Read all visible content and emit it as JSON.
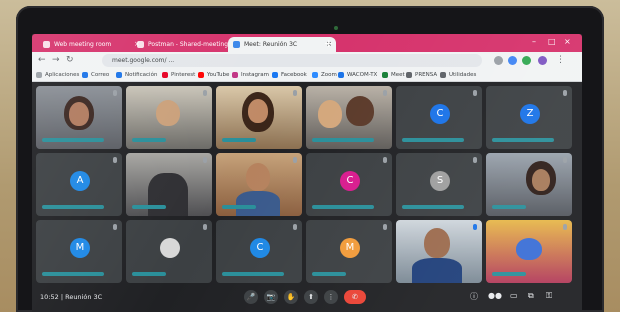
{
  "tabs": [
    {
      "label": "Web meeting room"
    },
    {
      "label": "Postman - Shared-meeting-..."
    },
    {
      "label": "Meet: Reunión 3C"
    }
  ],
  "address": {
    "url": "meet.google.com/ ... "
  },
  "bookmarks": [
    {
      "label": "Aplicaciones",
      "color": "#9aa0a6"
    },
    {
      "label": "Correo",
      "color": "#1a73e8"
    },
    {
      "label": "Notificación",
      "color": "#1a73e8"
    },
    {
      "label": "Pinterest",
      "color": "#e60023"
    },
    {
      "label": "YouTube",
      "color": "#ff0000"
    },
    {
      "label": "Instagram",
      "color": "#c13584"
    },
    {
      "label": "Facebook",
      "color": "#1877f2"
    },
    {
      "label": "Zoom",
      "color": "#2d8cff"
    },
    {
      "label": "WACOM-TX",
      "color": "#1a73e8"
    },
    {
      "label": "Meet",
      "color": "#188038"
    },
    {
      "label": "PRENSA",
      "color": "#5f6368"
    },
    {
      "label": "Utilidades",
      "color": "#5f6368"
    }
  ],
  "participants": [
    {
      "initial": "C",
      "color": "#1a73e8"
    },
    {
      "initial": "Z",
      "color": "#1a73e8"
    },
    {
      "initial": "A",
      "color": "#1e88e5"
    },
    {
      "initial": "C",
      "color": "#d81b8e"
    },
    {
      "initial": "S",
      "color": "#9e9e9e"
    },
    {
      "initial": "M",
      "color": "#1e88e5"
    },
    {
      "initial": "C",
      "color": "#1e88e5"
    },
    {
      "initial": "M",
      "color": "#f29b3a"
    }
  ],
  "meeting": {
    "time": "10:52",
    "separator": "|",
    "name": "Reunión 3C"
  },
  "controls": {
    "captions": "CC",
    "present": "⬆",
    "raise_hand": "✋",
    "more": "⋮",
    "end": "✆"
  },
  "icons": {
    "back": "←",
    "forward": "→",
    "reload": "↻",
    "new_tab": "+",
    "close": "×",
    "minimize": "–",
    "maximize": "□",
    "info": "ⓘ",
    "people": "👥",
    "chat": "💬",
    "activities": "⧉"
  }
}
